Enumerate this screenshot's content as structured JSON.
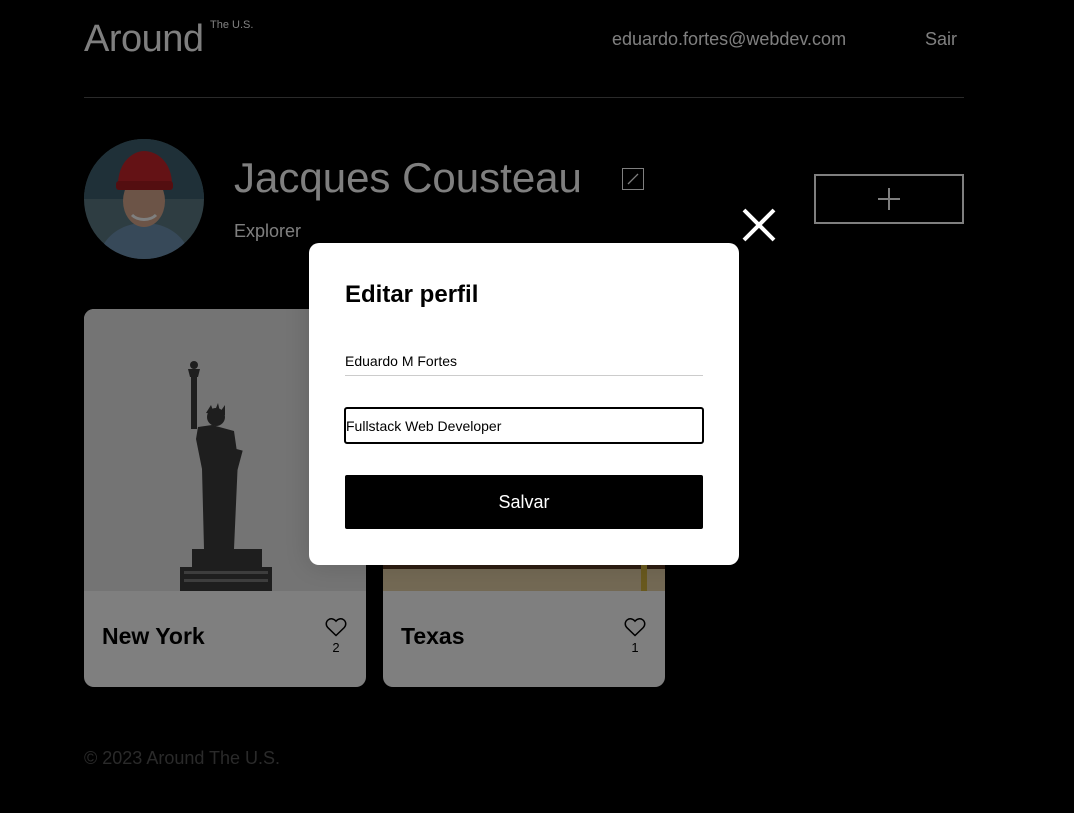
{
  "header": {
    "logo": "Around",
    "logo_sup": "The U.S.",
    "email": "eduardo.fortes@webdev.com",
    "logout": "Sair"
  },
  "profile": {
    "name": "Jacques Cousteau",
    "about": "Explorer"
  },
  "cards": [
    {
      "title": "New York",
      "likes": "2"
    },
    {
      "title": "Texas",
      "likes": "1"
    }
  ],
  "footer": {
    "text": "© 2023 Around The U.S."
  },
  "modal": {
    "title": "Editar perfil",
    "name_value": "Eduardo M Fortes",
    "about_value": "Fullstack Web Developer",
    "save_label": "Salvar"
  },
  "colors": {
    "background": "#000000",
    "modal_background": "#ffffff",
    "card_background": "#ffffff",
    "overlay": "rgba(0,0,0,0.5)",
    "muted": "#545454"
  },
  "icons": {
    "edit": "pencil-icon",
    "add": "plus-icon",
    "close": "close-icon",
    "like": "heart-outline-icon"
  }
}
